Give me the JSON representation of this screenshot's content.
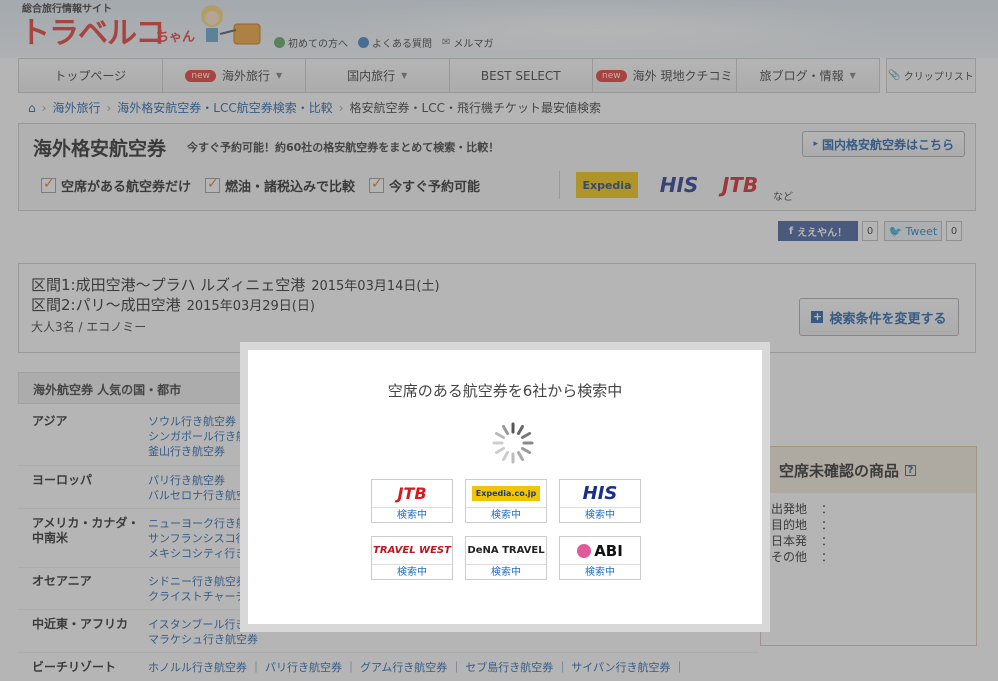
{
  "header": {
    "logo_sub": "総合旅行情報サイト",
    "logo": "トラベルコ",
    "logo_suffix": "ちゃん",
    "links": [
      "初めての方へ",
      "よくある質問",
      "メルマガ"
    ]
  },
  "nav": {
    "items": [
      {
        "label": "トップページ",
        "new": false,
        "caret": false
      },
      {
        "label": "海外旅行",
        "new": true,
        "caret": true
      },
      {
        "label": "国内旅行",
        "new": false,
        "caret": true
      },
      {
        "label": "BEST SELECT",
        "new": false,
        "caret": false
      },
      {
        "label": "海外 現地クチコミ",
        "new": true,
        "caret": false
      },
      {
        "label": "旅ブログ・情報",
        "new": false,
        "caret": true
      }
    ],
    "new_badge": "new",
    "clip_list": "クリップリスト"
  },
  "breadcrumb": [
    "海外旅行",
    "海外格安航空券・LCC航空券検索・比較",
    "格安航空券・LCC・飛行機チケット最安値検索"
  ],
  "title_box": {
    "title": "海外格安航空券",
    "description": "今すぐ予約可能！約60社の格安航空券をまとめて検索・比較！",
    "domestic_link": "国内格安航空券はこちら",
    "checks": [
      "空席がある航空券だけ",
      "燃油・諸税込みで比較",
      "今すぐ予約可能"
    ],
    "brands": [
      "Expedia",
      "HIS",
      "JTB"
    ],
    "brands_etc": "など"
  },
  "social": {
    "fb_label": "ええやん！",
    "fb_count": "0",
    "tweet_label": "Tweet",
    "tweet_count": "0"
  },
  "route": {
    "leg1": "区間1:成田空港～プラハ ルズィニェ空港",
    "leg1_date": "2015年03月14日(土)",
    "leg2": "区間2:パリ～成田空港",
    "leg2_date": "2015年03月29日(日)",
    "pax": "大人3名 / エコノミー",
    "change_button": "検索条件を変更する"
  },
  "popular": {
    "heading": "海外航空券 人気の国・都市",
    "rows": [
      {
        "region": "アジア",
        "cities": [
          "ソウル行き航空券",
          "シンガポール行き航空券",
          "釜山行き航空券"
        ]
      },
      {
        "region": "ヨーロッパ",
        "cities": [
          "パリ行き航空券",
          "バルセロナ行き航空券"
        ]
      },
      {
        "region": "アメリカ・カナダ・中南米",
        "cities": [
          "ニューヨーク行き航空券",
          "サンフランシスコ行き航空券",
          "メキシコシティ行き航空券"
        ]
      },
      {
        "region": "オセアニア",
        "cities": [
          "シドニー行き航空券",
          "クライストチャーチ行き航空券"
        ]
      },
      {
        "region": "中近東・アフリカ",
        "cities": [
          "イスタンブール行き航空券",
          "マラケシュ行き航空券"
        ]
      },
      {
        "region": "ビーチリゾート",
        "cities": [
          "ホノルル行き航空券 ｜ パリ行き航空券 ｜ グアム行き航空券 ｜ セブ島行き航空券 ｜ サイパン行き航空券 ｜"
        ]
      }
    ]
  },
  "right_panel": {
    "title": "空席未確認の商品",
    "rows": [
      {
        "k": "出発地",
        "v": "："
      },
      {
        "k": "目的地",
        "v": "："
      },
      {
        "k": "日本発",
        "v": "："
      },
      {
        "k": "その他",
        "v": "："
      }
    ]
  },
  "modal": {
    "title": "空席のある航空券を6社から検索中",
    "status": "検索中",
    "providers": [
      {
        "name": "JTB",
        "color": "#d81920"
      },
      {
        "name": "Expedia.co.jp",
        "color": "#1d3b7a"
      },
      {
        "name": "HIS",
        "color": "#1a2f8a"
      },
      {
        "name": "TRAVEL WEST",
        "color": "#c0141c"
      },
      {
        "name": "DeNA TRAVEL",
        "color": "#222222"
      },
      {
        "name": "ABI",
        "color": "#111111"
      }
    ]
  }
}
